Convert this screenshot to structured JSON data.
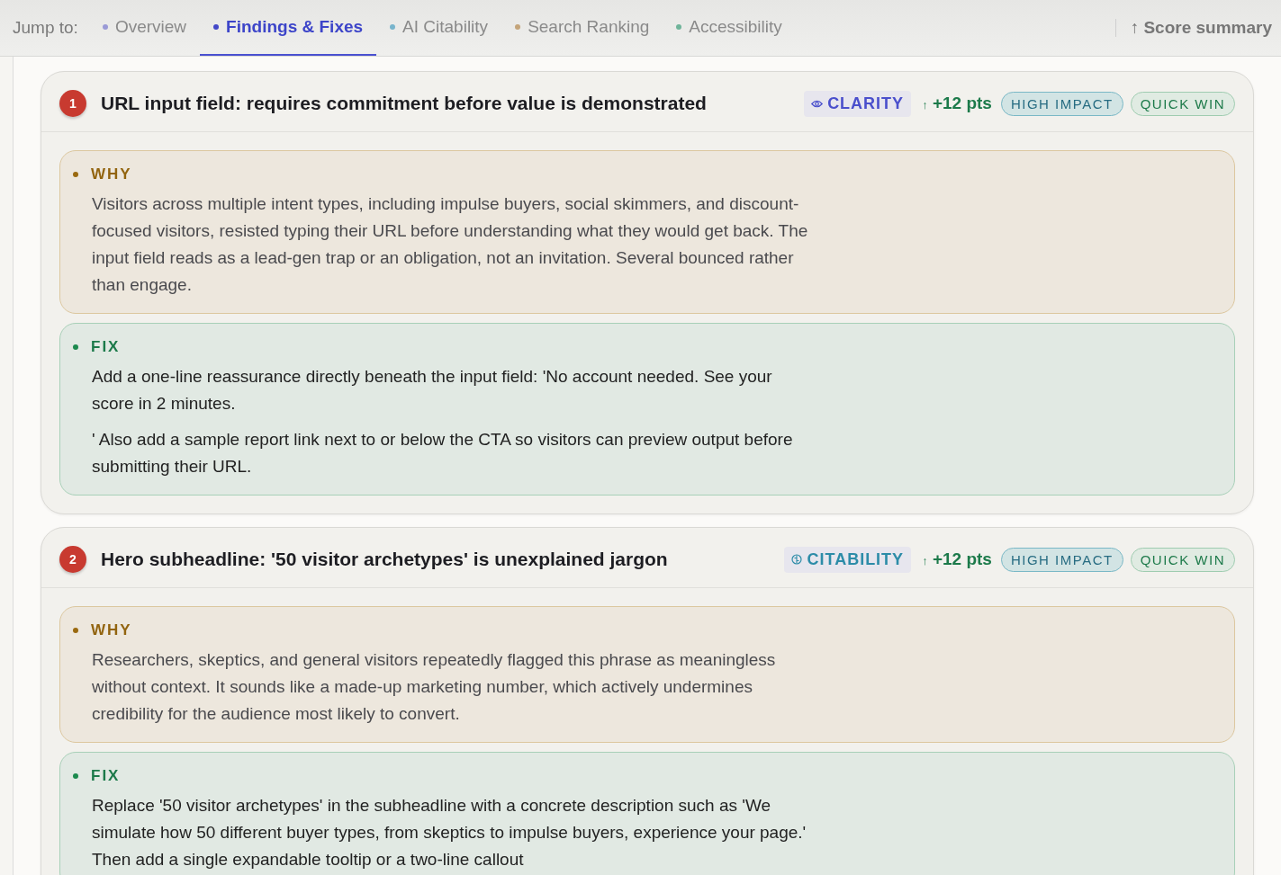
{
  "nav": {
    "label": "Jump to:",
    "items": [
      {
        "label": "Overview",
        "color": "#9a9ad6",
        "selected": false
      },
      {
        "label": "Findings & Fixes",
        "color": "#4348c8",
        "selected": true
      },
      {
        "label": "AI Citability",
        "color": "#78b4cc",
        "selected": false
      },
      {
        "label": "Search Ranking",
        "color": "#c4a47a",
        "selected": false
      },
      {
        "label": "Accessibility",
        "color": "#6fb49a",
        "selected": false
      }
    ],
    "summary": {
      "arrow": "↑",
      "label": "Score summary"
    }
  },
  "findings": [
    {
      "number": "1",
      "title": "URL input field: requires commitment before value is demonstrated",
      "category": {
        "kind": "clarity",
        "label": "CLARITY"
      },
      "points": {
        "arrow": "↑",
        "label": "+12 pts"
      },
      "tags": [
        {
          "kind": "impact",
          "label": "HIGH IMPACT"
        },
        {
          "kind": "win",
          "label": "QUICK WIN"
        }
      ],
      "sections": [
        {
          "kind": "why",
          "label": "WHY",
          "paragraphs": [
            "Visitors across multiple intent types, including impulse buyers, social skimmers, and discount-focused visitors, resisted typing their URL before understanding what they would get back. The input field reads as a lead-gen trap or an obligation, not an invitation. Several bounced rather than engage."
          ]
        },
        {
          "kind": "fix",
          "label": "FIX",
          "paragraphs": [
            "Add a one-line reassurance directly beneath the input field: 'No account needed. See your score in 2 minutes.",
            "' Also add a sample report link next to or below the CTA so visitors can preview output before submitting their URL."
          ]
        }
      ]
    },
    {
      "number": "2",
      "title": "Hero subheadline: '50 visitor archetypes' is unexplained jargon",
      "category": {
        "kind": "citability",
        "label": "CITABILITY"
      },
      "points": {
        "arrow": "↑",
        "label": "+12 pts"
      },
      "tags": [
        {
          "kind": "impact",
          "label": "HIGH IMPACT"
        },
        {
          "kind": "win",
          "label": "QUICK WIN"
        }
      ],
      "sections": [
        {
          "kind": "why",
          "label": "WHY",
          "paragraphs": [
            "Researchers, skeptics, and general visitors repeatedly flagged this phrase as meaningless without context. It sounds like a made-up marketing number, which actively undermines credibility for the audience most likely to convert."
          ]
        },
        {
          "kind": "fix",
          "label": "FIX",
          "paragraphs": [
            "Replace '50 visitor archetypes' in the subheadline with a concrete description such as 'We simulate how 50 different buyer types, from skeptics to impulse buyers, experience your page.' Then add a single expandable tooltip or a two-line callout"
          ]
        }
      ]
    }
  ]
}
